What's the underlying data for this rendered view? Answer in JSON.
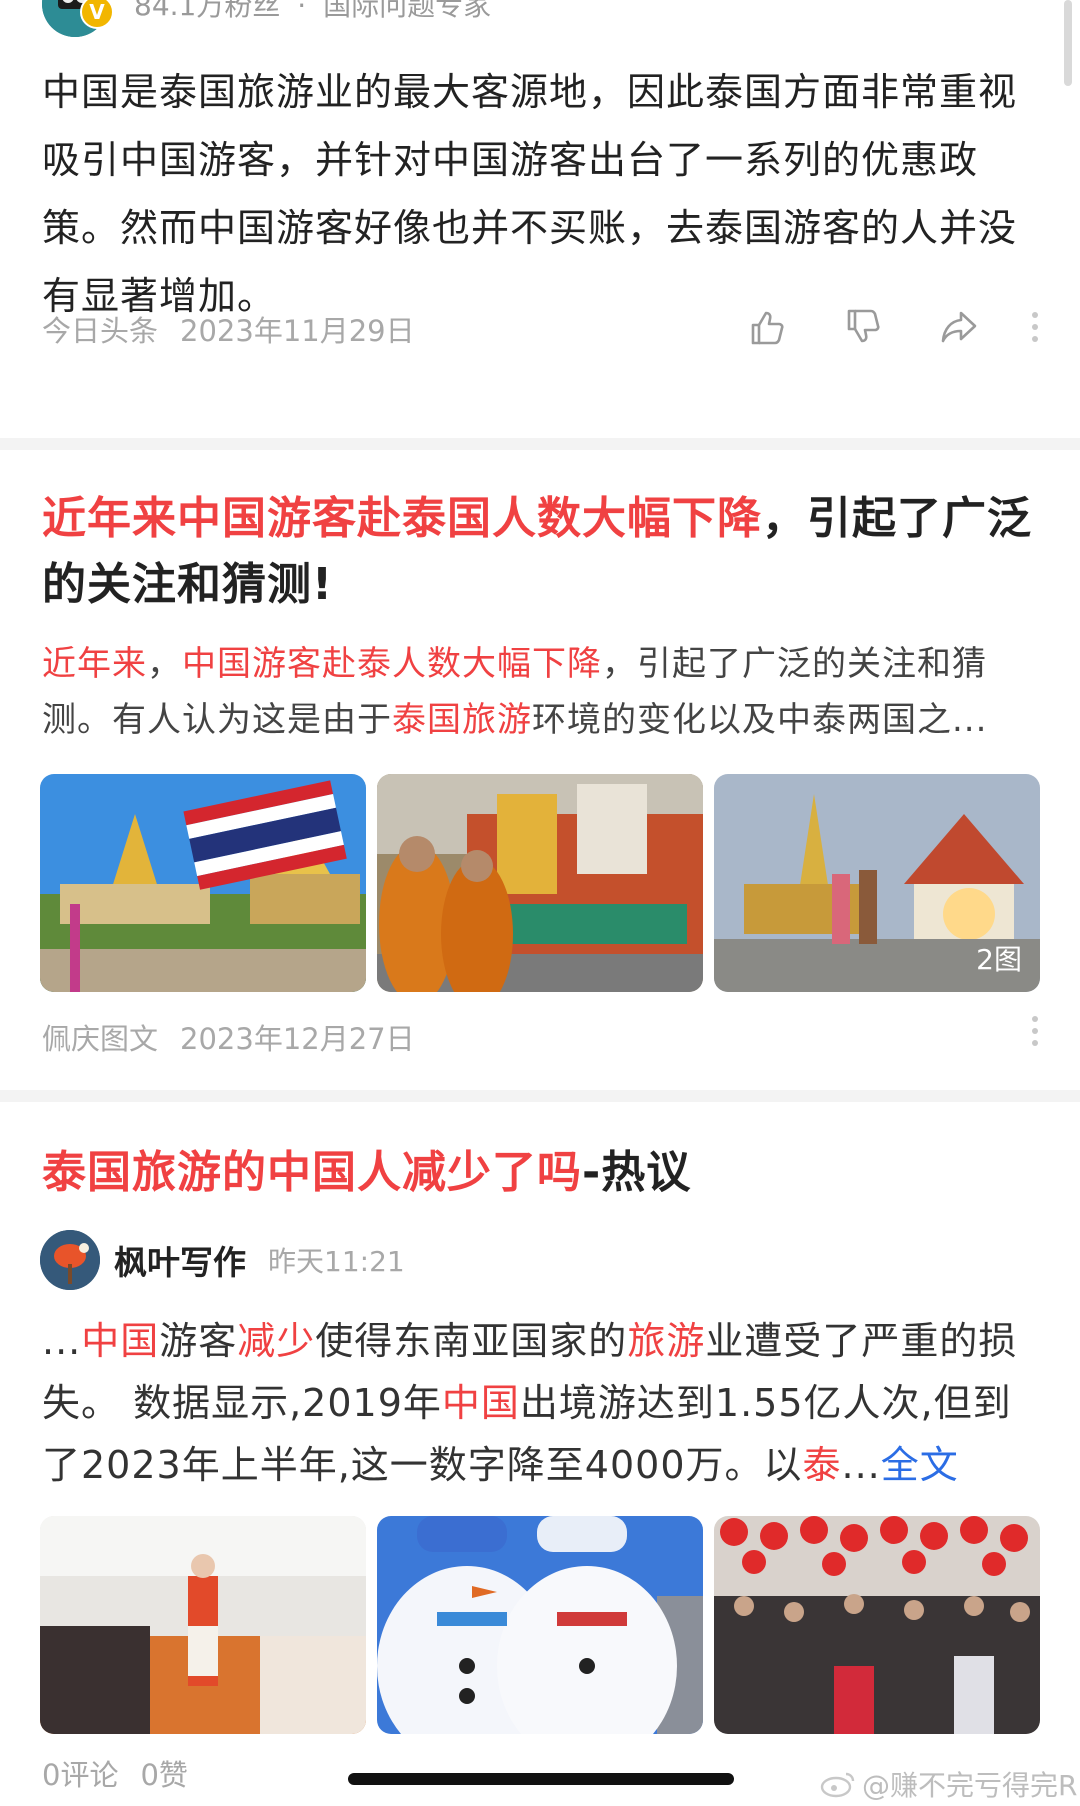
{
  "scrollbar": true,
  "card1": {
    "followers": "84.1万粉丝",
    "separator": "·",
    "author_title": "国际问题专家",
    "badge": "V",
    "body": "中国是泰国旅游业的最大客源地，因此泰国方面非常重视吸引中国游客，并针对中国游客出台了一系列的优惠政策。然而中国游客好像也并不买账，去泰国游客的人并没有显著增加。",
    "source": "今日头条",
    "date": "2023年11月29日",
    "icons": [
      "thumbs-up-icon",
      "thumbs-down-icon",
      "share-icon",
      "more-icon"
    ]
  },
  "card2": {
    "title_highlight": "近年来中国游客赴泰国人数大幅下降",
    "title_rest": "，引起了广泛的关注和猜测!",
    "summary": {
      "hl1": "近年来",
      "t1": "，",
      "hl2": "中国游客赴泰人数大幅下降",
      "t2": "，引起了广泛的关注和猜测。有人认为这是由于",
      "hl3": "泰国旅游",
      "t3": "环境的变化以及中泰两国之..."
    },
    "images": [
      {
        "name": "grand-palace-thai-flag"
      },
      {
        "name": "monks-parade-float"
      },
      {
        "name": "temple-tourists"
      }
    ],
    "image_count": "2图",
    "source": "佩庆图文",
    "date": "2023年12月27日"
  },
  "card3": {
    "title_highlight": "泰国旅游的中国人减少了吗",
    "title_rest": "-热议",
    "author": "枫叶写作",
    "time": "昨天11:21",
    "body": {
      "p0": "...",
      "hl1": "中国",
      "p1": "游客",
      "hl2": "减少",
      "p2": "使得东南亚国家的",
      "hl3": "旅游",
      "p3": "业遭受了严重的损失。 数据显示,2019年",
      "hl4": "中国",
      "p4": "出境游达到1.55亿人次,但到了2023年上半年,这一数字降至4000万。以",
      "hl5": "泰",
      "p5": "...",
      "full_text": "全文"
    },
    "images": [
      {
        "name": "airplane-cabin"
      },
      {
        "name": "snowmen-sculpture"
      },
      {
        "name": "crowd-red-lanterns"
      }
    ],
    "comments": "0评论",
    "likes": "0赞"
  },
  "watermark": "@赚不完亏得完R",
  "colors": {
    "highlight": "#f04142",
    "link": "#2b6de5",
    "meta": "#a8a8a8",
    "divider": "#f3f3f3"
  }
}
